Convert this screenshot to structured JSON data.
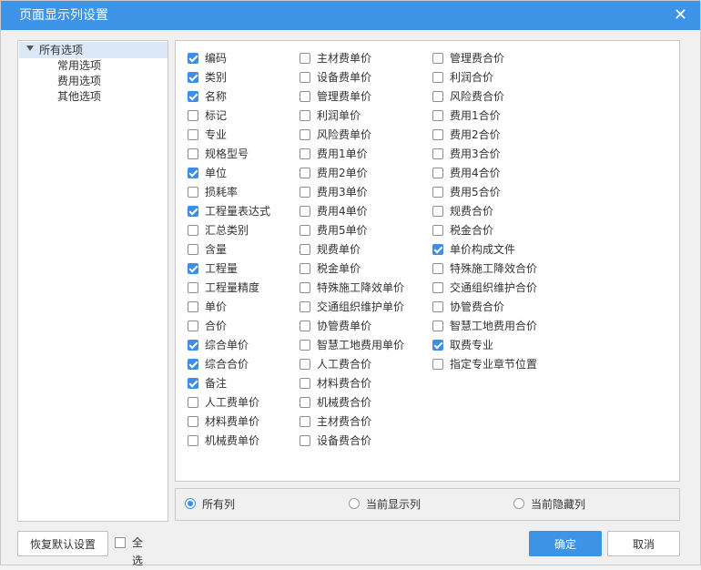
{
  "dialog": {
    "title": "页面显示列设置",
    "close_glyph": "✕"
  },
  "tree": {
    "root": "所有选项",
    "children": [
      "常用选项",
      "费用选项",
      "其他选项"
    ]
  },
  "columns": [
    [
      {
        "label": "编码",
        "checked": true
      },
      {
        "label": "类别",
        "checked": true
      },
      {
        "label": "名称",
        "checked": true
      },
      {
        "label": "标记",
        "checked": false
      },
      {
        "label": "专业",
        "checked": false
      },
      {
        "label": "规格型号",
        "checked": false
      },
      {
        "label": "单位",
        "checked": true
      },
      {
        "label": "损耗率",
        "checked": false
      },
      {
        "label": "工程量表达式",
        "checked": true
      },
      {
        "label": "汇总类别",
        "checked": false
      },
      {
        "label": "含量",
        "checked": false
      },
      {
        "label": "工程量",
        "checked": true
      },
      {
        "label": "工程量精度",
        "checked": false
      },
      {
        "label": "单价",
        "checked": false
      },
      {
        "label": "合价",
        "checked": false
      },
      {
        "label": "综合单价",
        "checked": true
      },
      {
        "label": "综合合价",
        "checked": true
      },
      {
        "label": "备注",
        "checked": true
      },
      {
        "label": "人工费单价",
        "checked": false
      },
      {
        "label": "材料费单价",
        "checked": false
      },
      {
        "label": "机械费单价",
        "checked": false
      }
    ],
    [
      {
        "label": "主材费单价",
        "checked": false
      },
      {
        "label": "设备费单价",
        "checked": false
      },
      {
        "label": "管理费单价",
        "checked": false
      },
      {
        "label": "利润单价",
        "checked": false
      },
      {
        "label": "风险费单价",
        "checked": false
      },
      {
        "label": "费用1单价",
        "checked": false
      },
      {
        "label": "费用2单价",
        "checked": false
      },
      {
        "label": "费用3单价",
        "checked": false
      },
      {
        "label": "费用4单价",
        "checked": false
      },
      {
        "label": "费用5单价",
        "checked": false
      },
      {
        "label": "规费单价",
        "checked": false
      },
      {
        "label": "税金单价",
        "checked": false
      },
      {
        "label": "特殊施工降效单价",
        "checked": false
      },
      {
        "label": "交通组织维护单价",
        "checked": false
      },
      {
        "label": "协管费单价",
        "checked": false
      },
      {
        "label": "智慧工地费用单价",
        "checked": false
      },
      {
        "label": "人工费合价",
        "checked": false
      },
      {
        "label": "材料费合价",
        "checked": false
      },
      {
        "label": "机械费合价",
        "checked": false
      },
      {
        "label": "主材费合价",
        "checked": false
      },
      {
        "label": "设备费合价",
        "checked": false
      }
    ],
    [
      {
        "label": "管理费合价",
        "checked": false
      },
      {
        "label": "利润合价",
        "checked": false
      },
      {
        "label": "风险费合价",
        "checked": false
      },
      {
        "label": "费用1合价",
        "checked": false
      },
      {
        "label": "费用2合价",
        "checked": false
      },
      {
        "label": "费用3合价",
        "checked": false
      },
      {
        "label": "费用4合价",
        "checked": false
      },
      {
        "label": "费用5合价",
        "checked": false
      },
      {
        "label": "规费合价",
        "checked": false
      },
      {
        "label": "税金合价",
        "checked": false
      },
      {
        "label": "单价构成文件",
        "checked": true
      },
      {
        "label": "特殊施工降效合价",
        "checked": false
      },
      {
        "label": "交通组织维护合价",
        "checked": false
      },
      {
        "label": "协管费合价",
        "checked": false
      },
      {
        "label": "智慧工地费用合价",
        "checked": false
      },
      {
        "label": "取费专业",
        "checked": true
      },
      {
        "label": "指定专业章节位置",
        "checked": false
      }
    ]
  ],
  "filter": {
    "options": [
      "所有列",
      "当前显示列",
      "当前隐藏列"
    ],
    "selected_index": 0
  },
  "footer": {
    "restore_label": "恢复默认设置",
    "select_all_label": "全选",
    "select_all_checked": false,
    "ok_label": "确定",
    "cancel_label": "取消"
  },
  "colors": {
    "accent": "#3d93e6"
  }
}
